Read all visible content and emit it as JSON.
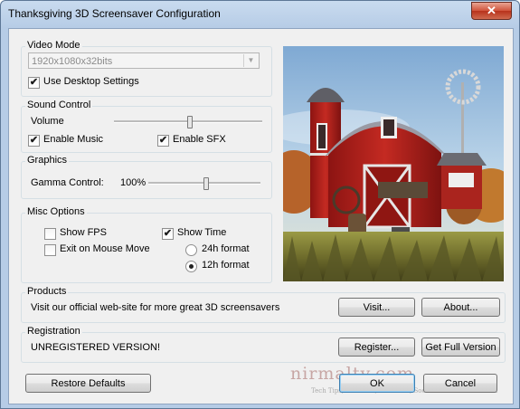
{
  "window": {
    "title": "Thanksgiving 3D Screensaver Configuration",
    "close_symbol": "✕"
  },
  "video_mode": {
    "title": "Video Mode",
    "resolution": "1920x1080x32bits",
    "use_desktop_settings_label": "Use Desktop Settings",
    "use_desktop_settings_checked": true
  },
  "sound": {
    "title": "Sound Control",
    "volume_label": "Volume",
    "volume_level": 0.51,
    "enable_music_label": "Enable Music",
    "enable_music_checked": true,
    "enable_sfx_label": "Enable SFX",
    "enable_sfx_checked": true
  },
  "graphics": {
    "title": "Graphics",
    "gamma_label": "Gamma Control:",
    "gamma_value": "100%",
    "gamma_level": 0.5
  },
  "misc": {
    "title": "Misc Options",
    "show_fps_label": "Show FPS",
    "show_fps_checked": false,
    "exit_on_mouse_label": "Exit on Mouse Move",
    "exit_on_mouse_checked": false,
    "show_time_label": "Show Time",
    "show_time_checked": true,
    "format_24h_label": "24h format",
    "format_12h_label": "12h format",
    "selected_format": "12h"
  },
  "products": {
    "title": "Products",
    "text": "Visit our official web-site for more great 3D screensavers",
    "visit_label": "Visit...",
    "about_label": "About..."
  },
  "registration": {
    "title": "Registration",
    "status": "UNREGISTERED VERSION!",
    "register_label": "Register...",
    "full_version_label": "Get Full Version"
  },
  "footer": {
    "restore_label": "Restore Defaults",
    "ok_label": "OK",
    "cancel_label": "Cancel"
  },
  "watermark": {
    "logo": "nirmaltv.com",
    "tagline": "Tech Tips, Windows, Freeware, Social Media and Internet"
  },
  "colors": {
    "barn_red": "#b0201c",
    "sky": "#aac8e2",
    "grass": "#8a8a3a"
  }
}
